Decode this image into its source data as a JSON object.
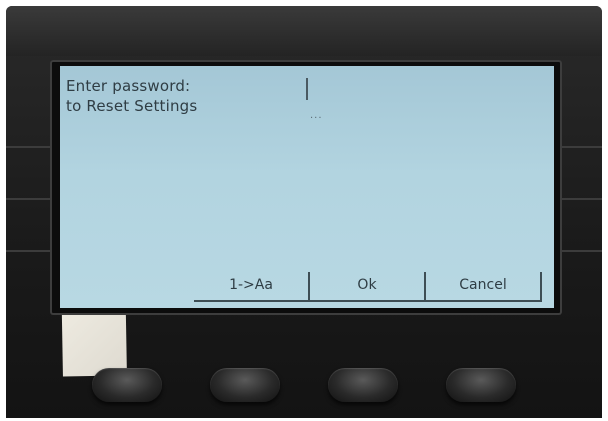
{
  "screen": {
    "prompt_line1": "Enter password:",
    "prompt_line2": "to Reset Settings",
    "input_placeholder": "..."
  },
  "softkeys": [
    {
      "label": "1->Aa"
    },
    {
      "label": "Ok"
    },
    {
      "label": "Cancel"
    }
  ],
  "colors": {
    "lcd_background": "#b2d4e0",
    "lcd_text": "#2f3d44",
    "device_body": "#1b1b1b"
  }
}
